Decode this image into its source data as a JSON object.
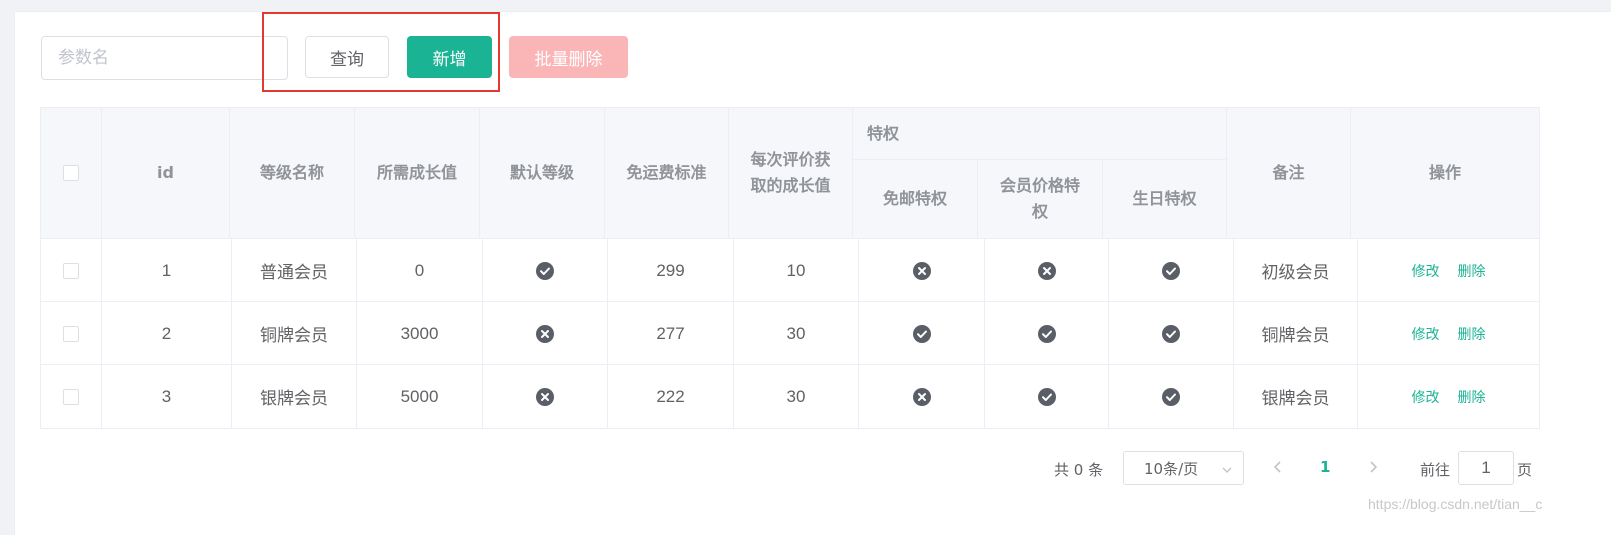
{
  "toolbar": {
    "search_placeholder": "参数名",
    "query_label": "查询",
    "add_label": "新增",
    "batch_delete_label": "批量删除"
  },
  "table": {
    "headers": {
      "id": "id",
      "name": "等级名称",
      "growth": "所需成长值",
      "default_level": "默认等级",
      "free_shipping": "免运费标准",
      "comment_growth": "每次评价获取的成长值",
      "privilege_group": "特权",
      "priv_free_mail": "免邮特权",
      "priv_member_price": "会员价格特权",
      "priv_birthday": "生日特权",
      "note": "备注",
      "action": "操作"
    },
    "rows": [
      {
        "id": "1",
        "name": "普通会员",
        "growth": "0",
        "default_level": true,
        "free_shipping": "299",
        "comment_growth": "10",
        "priv_free_mail": false,
        "priv_member_price": false,
        "priv_birthday": true,
        "note": "初级会员",
        "edit": "修改",
        "delete": "删除"
      },
      {
        "id": "2",
        "name": "铜牌会员",
        "growth": "3000",
        "default_level": false,
        "free_shipping": "277",
        "comment_growth": "30",
        "priv_free_mail": true,
        "priv_member_price": true,
        "priv_birthday": true,
        "note": "铜牌会员",
        "edit": "修改",
        "delete": "删除"
      },
      {
        "id": "3",
        "name": "银牌会员",
        "growth": "5000",
        "default_level": false,
        "free_shipping": "222",
        "comment_growth": "30",
        "priv_free_mail": false,
        "priv_member_price": true,
        "priv_birthday": true,
        "note": "银牌会员",
        "edit": "修改",
        "delete": "删除"
      }
    ]
  },
  "pagination": {
    "total_text": "共 0 条",
    "page_size": "10条/页",
    "current_page": "1",
    "goto_label": "前往",
    "goto_value": "1",
    "page_suffix": "页"
  },
  "watermark": "https://blog.csdn.net/tian__c",
  "colors": {
    "accent": "#1ab394",
    "danger_light": "#fab6b6",
    "highlight": "#e23a2f",
    "icon": "#5a5e66"
  }
}
